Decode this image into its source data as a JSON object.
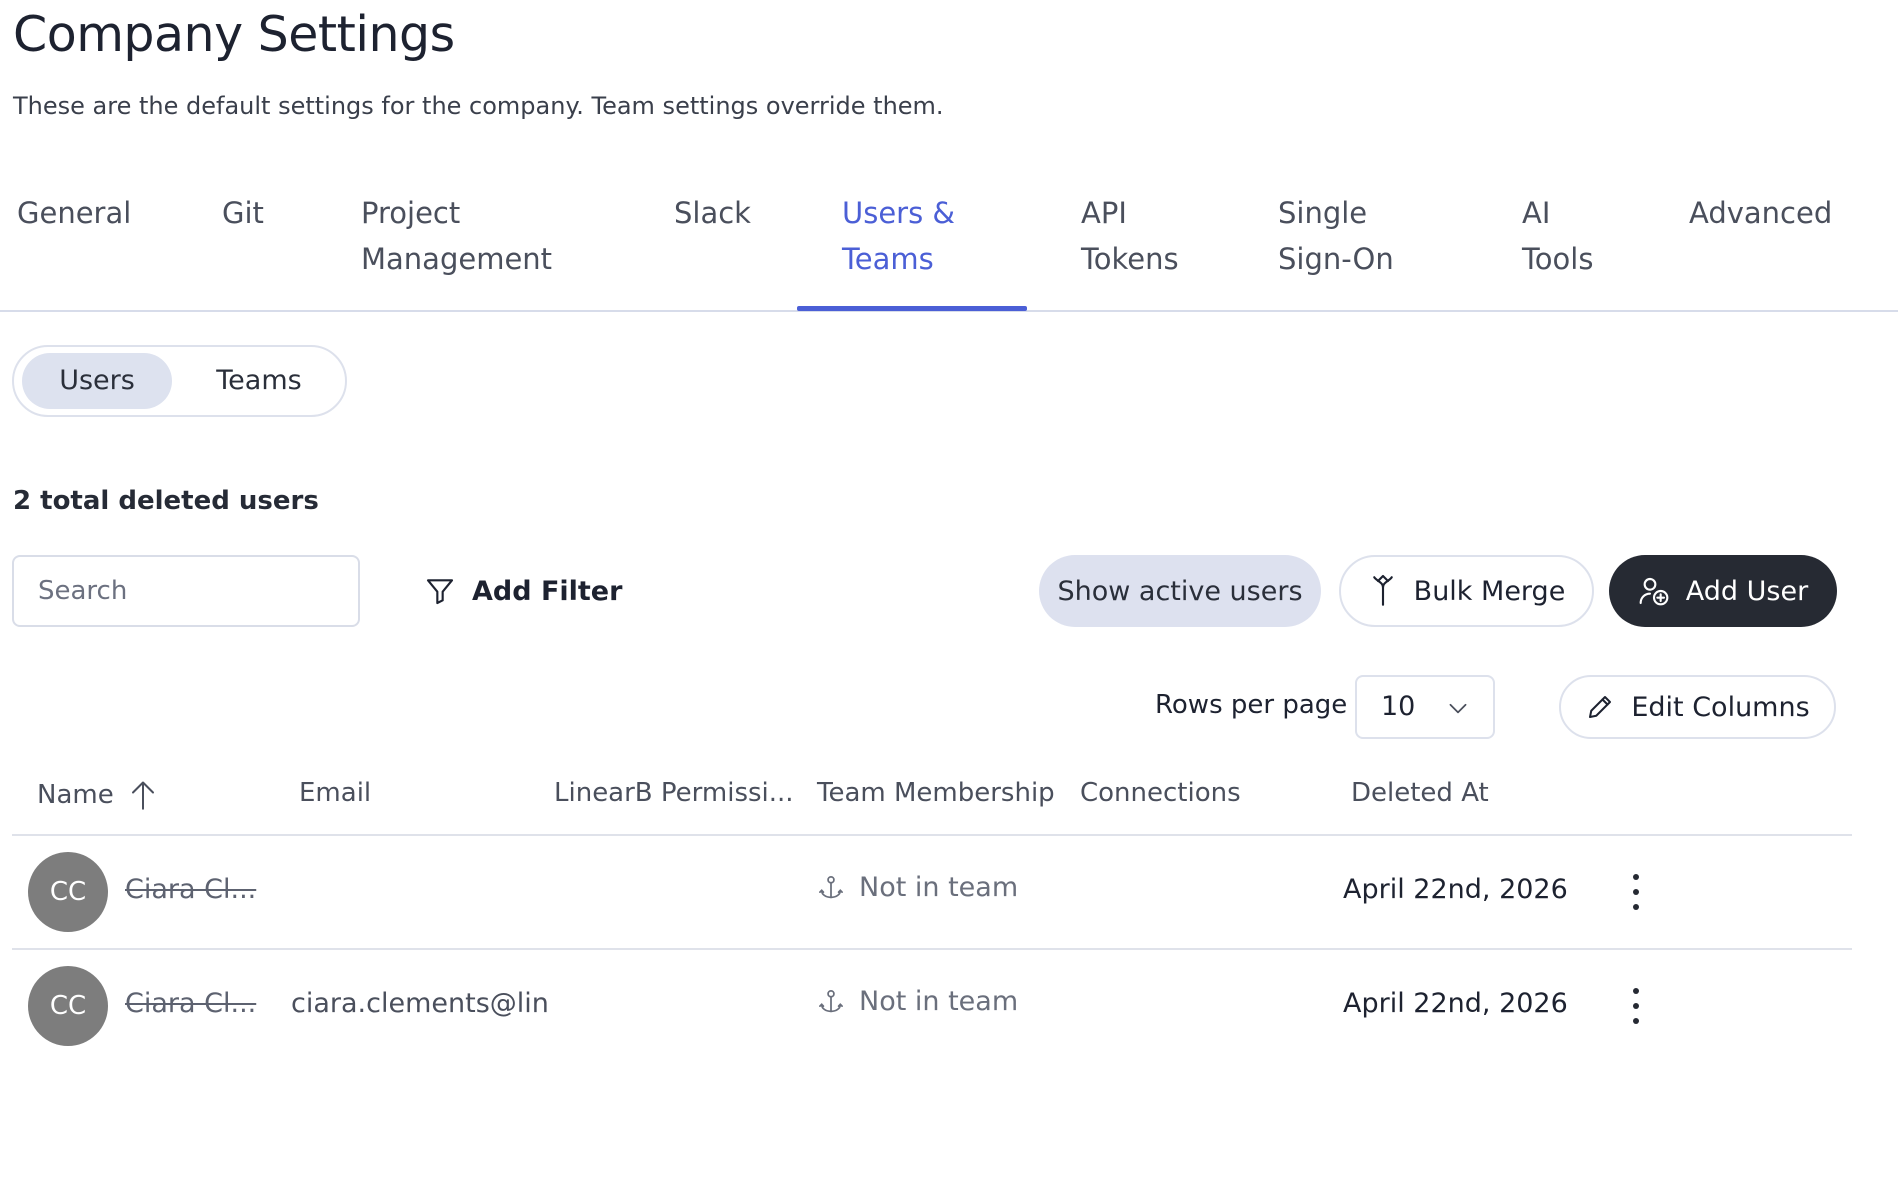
{
  "header": {
    "title": "Company Settings",
    "subtitle": "These are the default settings for the company. Team settings override them."
  },
  "tabs": [
    {
      "line1": "General",
      "line2": ""
    },
    {
      "line1": "Git",
      "line2": ""
    },
    {
      "line1": "Project",
      "line2": "Management"
    },
    {
      "line1": "Slack",
      "line2": ""
    },
    {
      "line1": "Users &",
      "line2": "Teams",
      "active": true
    },
    {
      "line1": "API",
      "line2": "Tokens"
    },
    {
      "line1": "Single",
      "line2": "Sign-On"
    },
    {
      "line1": "AI",
      "line2": "Tools"
    },
    {
      "line1": "Advanced",
      "line2": ""
    }
  ],
  "segmented": {
    "users_label": "Users",
    "teams_label": "Teams",
    "selected": "Users"
  },
  "summary": {
    "total_text": "2 total deleted users"
  },
  "toolbar": {
    "search_placeholder": "Search",
    "search_value": "",
    "add_filter_label": "Add Filter",
    "show_active_label": "Show active users",
    "bulk_merge_label": "Bulk Merge",
    "add_user_label": "Add User"
  },
  "pagination": {
    "rows_per_page_label": "Rows per page",
    "rows_per_page_value": "10",
    "edit_columns_label": "Edit Columns"
  },
  "table": {
    "columns": {
      "name": "Name",
      "email": "Email",
      "permission": "LinearB Permissi...",
      "team_membership": "Team Membership",
      "connections": "Connections",
      "deleted_at": "Deleted At"
    },
    "rows": [
      {
        "initials": "CC",
        "name": "Ciara Cl...",
        "email": "",
        "team": "Not in team",
        "deleted_at": "April 22nd, 2026"
      },
      {
        "initials": "CC",
        "name": "Ciara Cl...",
        "email": "ciara.clements@lin",
        "team": "Not in team",
        "deleted_at": "April 22nd, 2026"
      }
    ]
  },
  "colors": {
    "accent": "#4b5fd6",
    "primary_button": "#262a33",
    "avatar": "#7d7d7d"
  }
}
